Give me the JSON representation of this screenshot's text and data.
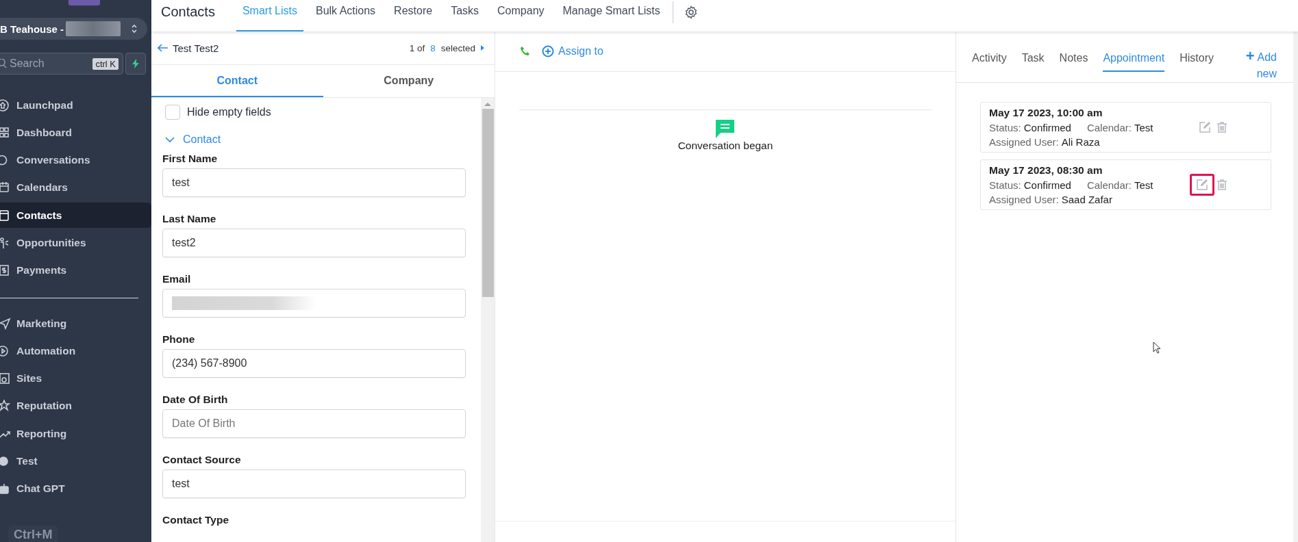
{
  "sidebar": {
    "location": {
      "name": "B Teahouse -",
      "redacted": true
    },
    "search": {
      "placeholder": "Search",
      "shortcut": "ctrl K"
    },
    "items": [
      {
        "label": "Launchpad",
        "selected": false
      },
      {
        "label": "Dashboard",
        "selected": false
      },
      {
        "label": "Conversations",
        "selected": false
      },
      {
        "label": "Calendars",
        "selected": false
      },
      {
        "label": "Contacts",
        "selected": true
      },
      {
        "label": "Opportunities",
        "selected": false
      },
      {
        "label": "Payments",
        "selected": false
      },
      {
        "kind": "divider"
      },
      {
        "label": "Marketing",
        "selected": false
      },
      {
        "label": "Automation",
        "selected": false
      },
      {
        "label": "Sites",
        "selected": false
      },
      {
        "label": "Reputation",
        "selected": false
      },
      {
        "label": "Reporting",
        "selected": false
      },
      {
        "label": "Test",
        "selected": false
      },
      {
        "label": "Chat GPT",
        "selected": false
      }
    ],
    "footer": "Ctrl+M"
  },
  "topbar": {
    "title": "Contacts",
    "tabs": [
      {
        "label": "Smart Lists",
        "selected": true
      },
      {
        "label": "Bulk Actions",
        "selected": false
      },
      {
        "label": "Restore",
        "selected": false
      },
      {
        "label": "Tasks",
        "selected": false
      },
      {
        "label": "Company",
        "selected": false
      },
      {
        "label": "Manage Smart Lists",
        "selected": false
      }
    ]
  },
  "contact_panel": {
    "name": "Test Test2",
    "pager": {
      "current": "1 of",
      "total": "8",
      "suffix": "selected"
    },
    "tabs": [
      {
        "label": "Contact",
        "selected": true
      },
      {
        "label": "Company",
        "selected": false
      }
    ],
    "hide_empty": {
      "label": "Hide empty fields",
      "checked": false
    },
    "section": {
      "title": "Contact",
      "expanded": true
    },
    "fields": [
      {
        "label": "First Name",
        "value": "test"
      },
      {
        "label": "Last Name",
        "value": "test2"
      },
      {
        "label": "Email",
        "kind": "redacted"
      },
      {
        "label": "Phone",
        "value": "(234) 567-8900"
      },
      {
        "label": "Date Of Birth",
        "placeholder": "Date Of Birth"
      },
      {
        "label": "Contact Source",
        "value": "test"
      },
      {
        "label": "Contact Type",
        "kind": "label_only"
      }
    ]
  },
  "conversation": {
    "assign": "Assign to",
    "event": "Conversation began"
  },
  "detail_panel": {
    "tabs": [
      {
        "label": "Activity",
        "selected": false
      },
      {
        "label": "Task",
        "selected": false
      },
      {
        "label": "Notes",
        "selected": false
      },
      {
        "label": "Appointment",
        "selected": true
      },
      {
        "label": "History",
        "selected": false
      }
    ],
    "add_icon": "+",
    "add_new": "Add new",
    "appointments": [
      {
        "datetime": "May 17 2023, 10:00 am",
        "status_label": "Status:",
        "status": "Confirmed",
        "calendar_label": "Calendar:",
        "calendar": "Test",
        "user_label": "Assigned User:",
        "user": "Ali Raza",
        "highlighted": false
      },
      {
        "datetime": "May 17 2023, 08:30 am",
        "status_label": "Status:",
        "status": "Confirmed",
        "calendar_label": "Calendar:",
        "calendar": "Test",
        "user_label": "Assigned User:",
        "user": "Saad Zafar",
        "highlighted": true
      }
    ]
  }
}
